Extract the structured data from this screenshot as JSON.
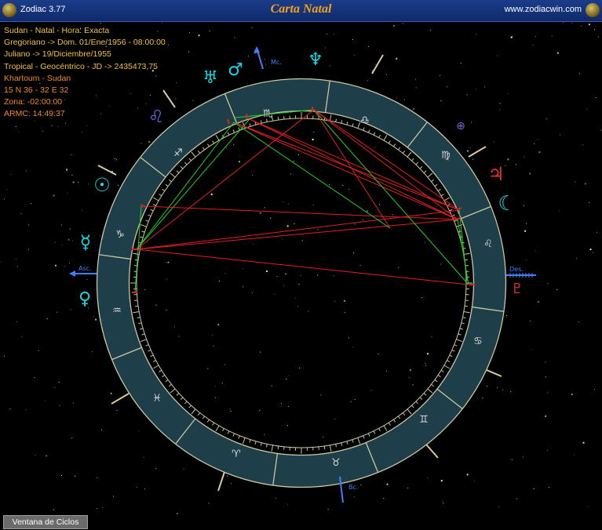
{
  "titlebar": {
    "app_name": "Zodiac 3.77",
    "chart_title": "Carta Natal",
    "website": "www.zodiacwin.com"
  },
  "info": {
    "line1": "Sudan - Natal - Hora: Exacta",
    "line2": "Gregoriano -> Dom. 01/Ene/1956 - 08:00:00",
    "line3": "Juliano -> 19/Diciembre/1955",
    "line4": "Tropical - Geocéntrico - JD -> 2435473,75",
    "line5": "Khartoum - Sudan",
    "line6": "15 N 36 - 32 E 32",
    "line7": "Zona: -02:00:00",
    "line8": "ARMC: 14:49:37"
  },
  "axes": {
    "asc": "Asc.",
    "des": "Des.",
    "mc": "Mc.",
    "bc": "Bc."
  },
  "colors": {
    "wheel_band": "#1e3f4a",
    "wheel_line": "#c8c8a0",
    "sign_glyph": "#dcdcdc",
    "planet": "#19d6e6",
    "planet_mars_jupiter": "#e0303a",
    "node": "#8060d0",
    "aspect_hard": "#e02020",
    "aspect_soft": "#20d020",
    "axis": "#4080ff"
  },
  "signs": {
    "sign_1": "♎",
    "sign_2": "♏",
    "sign_3": "♐",
    "sign_4": "♑",
    "sign_5": "♒",
    "sign_6": "♓",
    "sign_7": "♈",
    "sign_8": "♉",
    "sign_9": "♊",
    "sign_10": "♋",
    "sign_11": "♌",
    "sign_12": "♍"
  },
  "planets": {
    "uranus": "♅",
    "mars": "♂",
    "chiron": "⚷",
    "neptune": "♆",
    "leo_sign_outer": "♌",
    "sun": "☉",
    "mercury": "☿",
    "venus": "♀",
    "pars_fortuna": "⊕",
    "jupiter": "♃",
    "moon": "☾",
    "pluto": "♇"
  },
  "bottom": {
    "button_label": "Ventana de Ciclos"
  }
}
